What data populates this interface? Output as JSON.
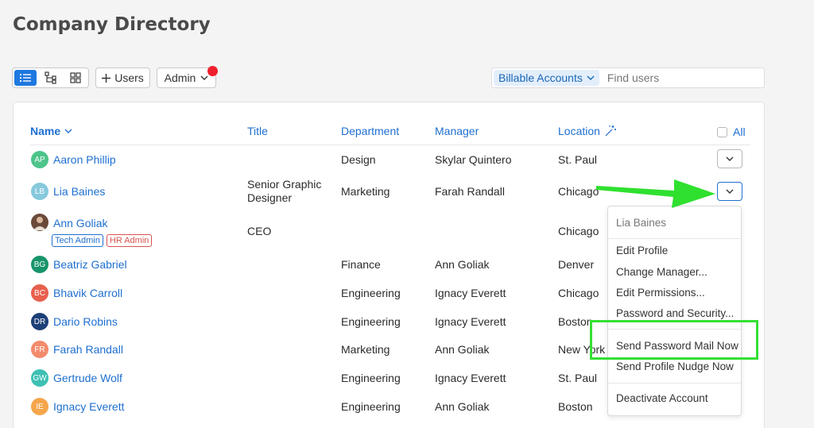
{
  "page": {
    "title": "Company Directory"
  },
  "toolbar": {
    "add_users_label": "Users",
    "admin_label": "Admin",
    "billable_label": "Billable Accounts",
    "search_placeholder": "Find users"
  },
  "table": {
    "headers": {
      "name": "Name",
      "title": "Title",
      "department": "Department",
      "manager": "Manager",
      "location": "Location",
      "all": "All"
    },
    "rows": [
      {
        "initials": "AP",
        "name": "Aaron Phillip",
        "title": "",
        "department": "Design",
        "manager": "Skylar Quintero",
        "location": "St. Paul",
        "color": "#4cc48a"
      },
      {
        "initials": "LB",
        "name": "Lia Baines",
        "title": "Senior Graphic Designer",
        "title_line1": "Senior Graphic",
        "title_line2": "Designer",
        "department": "Marketing",
        "manager": "Farah Randall",
        "location": "Chicago",
        "color": "#86c9dc"
      },
      {
        "initials": "",
        "name": "Ann Goliak",
        "title": "CEO",
        "department": "",
        "manager": "",
        "location": "Chicago",
        "tags": [
          "Tech Admin",
          "HR Admin"
        ],
        "color": "#6b4a3a"
      },
      {
        "initials": "BG",
        "name": "Beatriz Gabriel",
        "title": "",
        "department": "Finance",
        "manager": "Ann Goliak",
        "location": "Denver",
        "color": "#17946b"
      },
      {
        "initials": "BC",
        "name": "Bhavik Carroll",
        "title": "",
        "department": "Engineering",
        "manager": "Ignacy Everett",
        "location": "Chicago",
        "color": "#e8604e"
      },
      {
        "initials": "DR",
        "name": "Dario Robins",
        "title": "",
        "department": "Engineering",
        "manager": "Ignacy Everett",
        "location": "Boston",
        "color": "#1c3f78"
      },
      {
        "initials": "FR",
        "name": "Farah Randall",
        "title": "",
        "department": "Marketing",
        "manager": "Ann Goliak",
        "location": "New York",
        "color": "#f28b6c"
      },
      {
        "initials": "GW",
        "name": "Gertrude Wolf",
        "title": "",
        "department": "Engineering",
        "manager": "Ignacy Everett",
        "location": "St. Paul",
        "color": "#3ec0b4"
      },
      {
        "initials": "IE",
        "name": "Ignacy Everett",
        "title": "",
        "department": "Engineering",
        "manager": "Ann Goliak",
        "location": "Boston",
        "color": "#f5a54a"
      }
    ]
  },
  "menu": {
    "header": "Lia Baines",
    "items": [
      "Edit Profile",
      "Change Manager...",
      "Edit Permissions...",
      "Password and Security...",
      "Send Password Mail Now",
      "Send Profile Nudge Now",
      "Deactivate Account"
    ]
  },
  "colors": {
    "accent": "#1e78e0",
    "link": "#1e6fd0",
    "highlight": "#34e034",
    "notification": "#f0202d"
  }
}
